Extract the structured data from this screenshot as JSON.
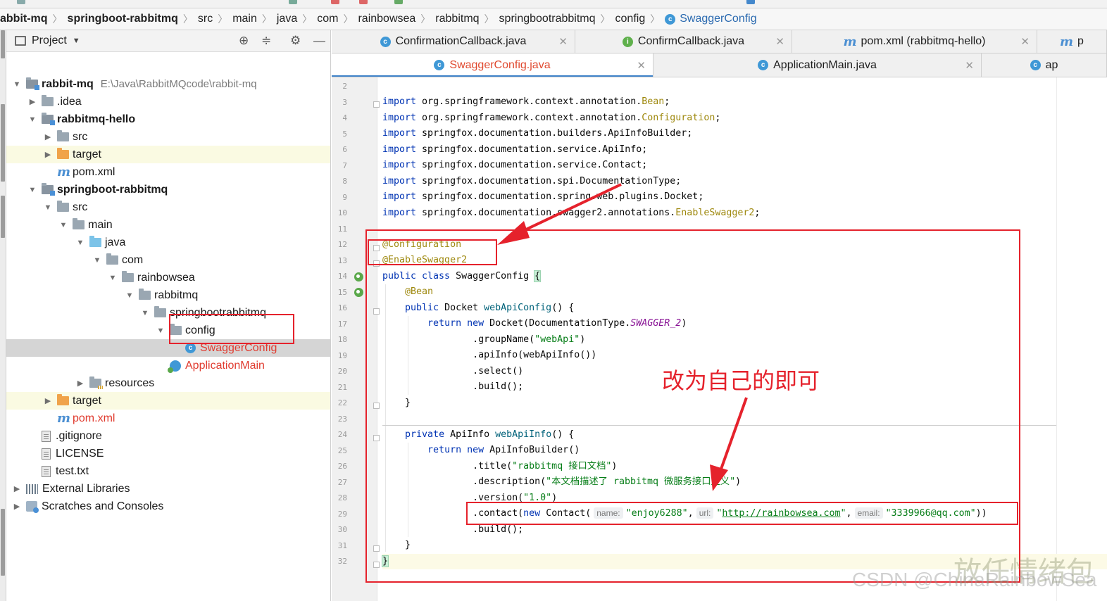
{
  "colors": {
    "accent_tab": "#e0492f",
    "annotation_red": "#e5222c",
    "keyword": "#0033b3",
    "string": "#067d17",
    "annotation": "#9e880d"
  },
  "breadcrumb": [
    {
      "label": "abbit-mq",
      "bold": true
    },
    {
      "label": "springboot-rabbitmq",
      "bold": true
    },
    {
      "label": "src"
    },
    {
      "label": "main"
    },
    {
      "label": "java"
    },
    {
      "label": "com"
    },
    {
      "label": "rainbowsea"
    },
    {
      "label": "rabbitmq"
    },
    {
      "label": "springbootrabbitmq"
    },
    {
      "label": "config"
    },
    {
      "label": "SwaggerConfig",
      "icon": "class-icon"
    }
  ],
  "project_panel": {
    "title": "Project",
    "tree": [
      {
        "label": "rabbit-mq",
        "extra": "E:\\Java\\RabbitMQcode\\rabbit-mq",
        "icon": "module",
        "arrow": "down",
        "bold": true
      },
      {
        "label": ".idea",
        "icon": "folder",
        "arrow": "right"
      },
      {
        "label": "rabbitmq-hello",
        "icon": "module",
        "arrow": "down",
        "bold": true
      },
      {
        "label": "src",
        "icon": "folder",
        "arrow": "right"
      },
      {
        "label": "target",
        "icon": "orange",
        "arrow": "right",
        "highlight": true
      },
      {
        "label": "pom.xml",
        "icon": "maven"
      },
      {
        "label": "springboot-rabbitmq",
        "icon": "module",
        "arrow": "down",
        "bold": true
      },
      {
        "label": "src",
        "icon": "folder",
        "arrow": "down"
      },
      {
        "label": "main",
        "icon": "folder",
        "arrow": "down"
      },
      {
        "label": "java",
        "icon": "blue",
        "arrow": "down"
      },
      {
        "label": "com",
        "icon": "folder",
        "arrow": "down"
      },
      {
        "label": "rainbowsea",
        "icon": "folder",
        "arrow": "down"
      },
      {
        "label": "rabbitmq",
        "icon": "folder",
        "arrow": "down"
      },
      {
        "label": "springbootrabbitmq",
        "icon": "folder",
        "arrow": "down"
      },
      {
        "label": "config",
        "icon": "folder",
        "arrow": "down"
      },
      {
        "label": "SwaggerConfig",
        "icon": "class",
        "selected": true,
        "red": true
      },
      {
        "label": "ApplicationMain",
        "icon": "app",
        "red": true
      },
      {
        "label": "resources",
        "icon": "res",
        "arrow": "right"
      },
      {
        "label": "target",
        "icon": "orange",
        "arrow": "right",
        "highlight": true
      },
      {
        "label": "pom.xml",
        "icon": "maven",
        "red": true
      },
      {
        "label": ".gitignore",
        "icon": "file"
      },
      {
        "label": "LICENSE",
        "icon": "file"
      },
      {
        "label": "test.txt",
        "icon": "file"
      },
      {
        "label": "External Libraries",
        "icon": "lib",
        "arrow": "right"
      },
      {
        "label": "Scratches and Consoles",
        "icon": "scratch",
        "arrow": "right"
      }
    ]
  },
  "tabs_row1": [
    {
      "label": "ConfirmationCallback.java",
      "icon": "c"
    },
    {
      "label": "ConfirmCallback.java",
      "icon": "i"
    },
    {
      "label": "pom.xml (rabbitmq-hello)",
      "icon": "m"
    },
    {
      "label": "p",
      "icon": "m"
    }
  ],
  "tabs_row2": [
    {
      "label": "SwaggerConfig.java",
      "icon": "c",
      "active": true
    },
    {
      "label": "ApplicationMain.java",
      "icon": "c"
    },
    {
      "label": "ap",
      "icon": "c"
    }
  ],
  "editor": {
    "line_numbers": [
      2,
      3,
      4,
      5,
      6,
      7,
      8,
      9,
      10,
      11,
      12,
      13,
      14,
      15,
      16,
      17,
      18,
      19,
      20,
      21,
      22,
      23,
      24,
      25,
      26,
      27,
      28,
      29,
      30,
      31,
      32
    ],
    "code": {
      "imp1_pkg": " org.springframework.context.annotation.",
      "imp1_cls": "Bean",
      "imp2_pkg": " org.springframework.context.annotation.",
      "imp2_cls": "Configuration",
      "imp3": " springfox.documentation.builders.ApiInfoBuilder;",
      "imp4": " springfox.documentation.service.ApiInfo;",
      "imp5": " springfox.documentation.service.Contact;",
      "imp6": " springfox.documentation.spi.DocumentationType;",
      "imp7": " springfox.documentation.spring.web.plugins.Docket;",
      "imp8_pkg": " springfox.documentation.swagger2.annotations.",
      "imp8_cls": "EnableSwagger2",
      "kw_import": "import",
      "ann_config": "@Configuration",
      "ann_swagger": "@EnableSwagger2",
      "class_kw": "public class",
      "class_name": " SwaggerConfig ",
      "ann_bean": "@Bean",
      "m1_sig_kw": "public",
      "m1_type": " Docket ",
      "m1_name": "webApiConfig",
      "m1_tail": "() {",
      "ret1_kw": "return new",
      "ret1_a": " Docket(DocumentationType.",
      "ret1_field": "SWAGGER_2",
      "ret1_b": ")",
      "group_a": ".groupName(",
      "group_str": "\"webApi\"",
      "group_b": ")",
      "apiinfo": ".apiInfo(webApiInfo())",
      "select": ".select()",
      "build1": ".build();",
      "close1": "}",
      "m2_kw": "private",
      "m2_type": " ApiInfo ",
      "m2_name": "webApiInfo",
      "m2_tail": "() {",
      "ret2_kw": "return new",
      "ret2_a": " ApiInfoBuilder()",
      "title_a": ".title(",
      "title_str": "\"rabbitmq 接口文档\"",
      "title_b": ")",
      "desc_a": ".description(",
      "desc_str": "\"本文档描述了 rabbitmq 微服务接口定义\"",
      "desc_b": ")",
      "ver_a": ".version(",
      "ver_str": "\"1.0\"",
      "ver_b": ")",
      "contact_a": ".contact(",
      "contact_kw": "new",
      "contact_b": " Contact(",
      "hint_name": "name:",
      "name_str": "\"enjoy6288\"",
      "comma": ",",
      "hint_url": "url:",
      "url_q1": "\"",
      "url_str": "http://rainbowsea.com",
      "url_q2": "\"",
      "hint_email": "email:",
      "email_str": "\"3339966@qq.com\"",
      "contact_c": "))",
      "build2": ".build();",
      "close2": "}",
      "close3": "}"
    }
  },
  "annotations": {
    "note": "改为自己的即可"
  },
  "watermark": {
    "cn": "放任情绪包",
    "csdn": "CSDN @ChinaRainbowSea"
  }
}
